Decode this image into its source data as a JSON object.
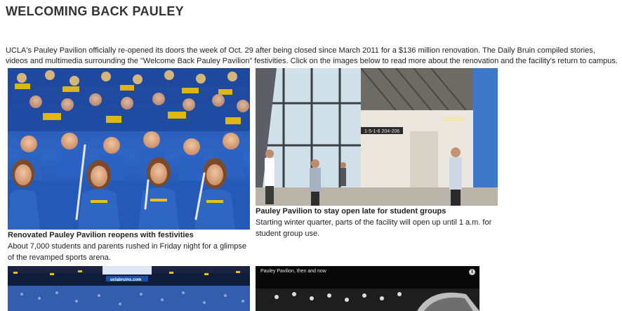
{
  "page": {
    "title": "WELCOMING BACK PAULEY",
    "intro": "UCLA's Pauley Pavilion officially re-opened its doors the week of Oct. 29 after being closed since March 2011 for a $136 million renovation. The Daily Bruin compiled stories, videos and multimedia surrounding the \"Welcome Back Pauley Pavilion\" festivities. Click on the images below to read more about the renovation and the facility's return to campus."
  },
  "stories": [
    {
      "title": "Renovated Pauley Pavilion reopens with festivities",
      "description": "About 7,000 students and parents rushed in Friday night for a glimpse of the revamped sports arena."
    },
    {
      "title": "Pauley Pavilion to stay open late for student groups",
      "description": "Starting winter quarter, parts of the facility will open up until 1 a.m. for student group use."
    }
  ],
  "media": {
    "lobby_sign": "1-5-1-6 204-206",
    "arena_banner": "uclabruins.com",
    "video_label": "Pauley Pavilion, then and now",
    "info_icon_glyph": "i"
  },
  "colors": {
    "ucla_blue": "#2f66c4",
    "ucla_gold": "#f2c200"
  }
}
